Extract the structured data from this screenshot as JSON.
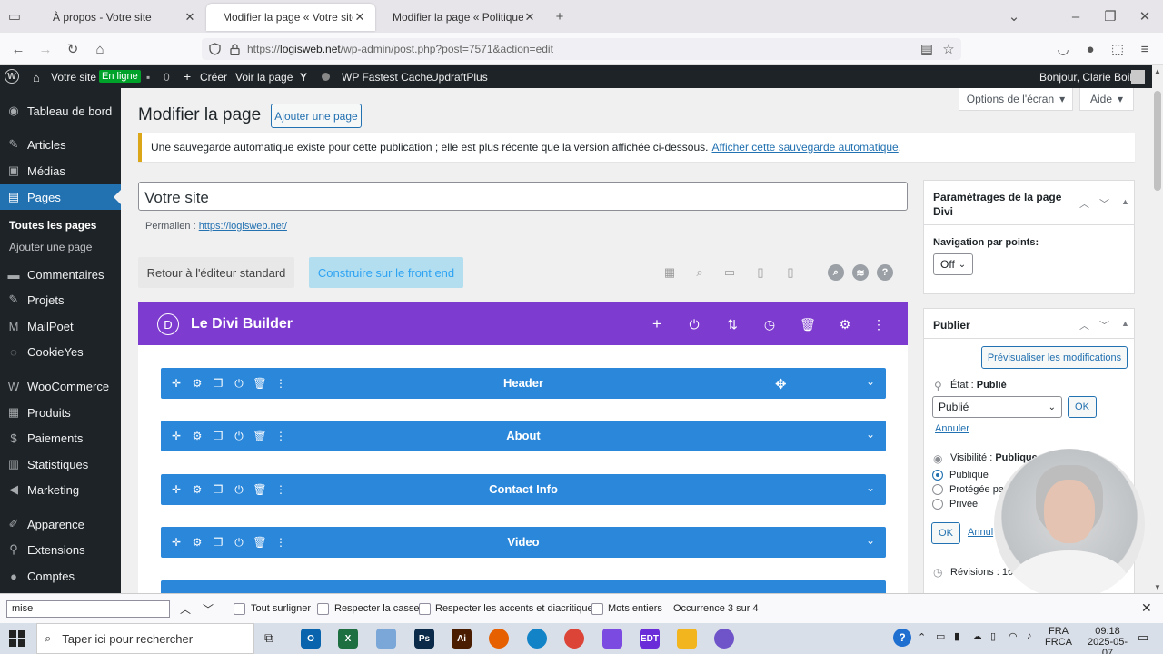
{
  "browser": {
    "tabs": [
      {
        "title": "À propos - Votre site",
        "active": false
      },
      {
        "title": "Modifier la page « Votre site » ‹",
        "active": true
      },
      {
        "title": "Modifier la page « Politique rela",
        "active": false
      }
    ],
    "url_prefix": "https://",
    "url_host": "logisweb.net",
    "url_path": "/wp-admin/post.php?post=7571&action=edit"
  },
  "adminbar": {
    "site_name": "Votre site",
    "online_badge": "En ligne",
    "comments_count": "0",
    "create": "Créer",
    "view_page": "Voir la page",
    "fastest_cache": "WP Fastest Cache",
    "updraft": "UpdraftPlus",
    "greeting": "Bonjour, Clarie Boily"
  },
  "sidebar": {
    "items": [
      {
        "label": "Tableau de bord",
        "icon": "dashboard-icon"
      },
      {
        "label": "Articles",
        "icon": "pin-icon"
      },
      {
        "label": "Médias",
        "icon": "media-icon"
      },
      {
        "label": "Pages",
        "icon": "pages-icon"
      },
      {
        "label": "Commentaires",
        "icon": "comment-icon"
      },
      {
        "label": "Projets",
        "icon": "pin-icon"
      },
      {
        "label": "MailPoet",
        "icon": "mailpoet-icon"
      },
      {
        "label": "CookieYes",
        "icon": "cookie-icon"
      },
      {
        "label": "WooCommerce",
        "icon": "woo-icon"
      },
      {
        "label": "Produits",
        "icon": "box-icon"
      },
      {
        "label": "Paiements",
        "icon": "card-icon"
      },
      {
        "label": "Statistiques",
        "icon": "chart-icon"
      },
      {
        "label": "Marketing",
        "icon": "megaphone-icon"
      },
      {
        "label": "Apparence",
        "icon": "brush-icon"
      },
      {
        "label": "Extensions",
        "icon": "plugin-icon"
      },
      {
        "label": "Comptes",
        "icon": "user-icon"
      }
    ],
    "sub_all": "Toutes les pages",
    "sub_add": "Ajouter une page"
  },
  "screen_options": "Options de l'écran",
  "help": "Aide",
  "page_title": "Modifier la page",
  "add_page": "Ajouter une page",
  "notice": {
    "text": "Une sauvegarde automatique existe pour cette publication ; elle est plus récente que la version affichée ci-dessous.",
    "link": "Afficher cette sauvegarde automatique",
    "end": "."
  },
  "post_title": "Votre site",
  "permalink_label": "Permalien :",
  "permalink_url": "https://logisweb.net/",
  "btn_standard": "Retour à l'éditeur standard",
  "btn_frontend": "Construire sur le front end",
  "divi": {
    "logo": "D",
    "title": "Le Divi Builder",
    "sections": [
      "Header",
      "About",
      "Contact Info",
      "Video"
    ]
  },
  "divi_settings": {
    "title_line1": "Paramétrages de la page",
    "title_line2": "Divi",
    "dot_nav_label": "Navigation par points:",
    "dot_nav_value": "Off"
  },
  "publish": {
    "title": "Publier",
    "preview": "Prévisualiser les modifications",
    "state_label": "État :",
    "state_value": "Publié",
    "select_value": "Publié",
    "ok": "OK",
    "cancel": "Annuler",
    "visibility_label": "Visibilité :",
    "visibility_value": "Publique",
    "radio_public": "Publique",
    "radio_protected": "Protégée pa",
    "radio_private": "Privée",
    "ok2": "OK",
    "cancel2": "Annul",
    "revisions": "Révisions : 16"
  },
  "findbar": {
    "query": "mise",
    "highlight_all": "Tout surligner",
    "match_case": "Respecter la casse",
    "match_diacritics": "Respecter les accents et diacritiques",
    "whole_words": "Mots entiers",
    "occurrence": "Occurrence 3 sur 4"
  },
  "taskbar": {
    "search_placeholder": "Taper ici pour rechercher",
    "lang1": "FRA",
    "lang2": "FRCA",
    "time": "09:18",
    "date": "2025-05-07",
    "apps": [
      {
        "name": "outlook",
        "label": "O",
        "color": "#0a64ad"
      },
      {
        "name": "excel",
        "label": "X",
        "color": "#1d6f42"
      },
      {
        "name": "notepad",
        "label": "",
        "color": "#7aa7d8"
      },
      {
        "name": "photoshop",
        "label": "Ps",
        "color": "#0b2a4a"
      },
      {
        "name": "illustrator",
        "label": "Ai",
        "color": "#4a1d00"
      },
      {
        "name": "firefox",
        "label": "",
        "color": "#e66000"
      },
      {
        "name": "edge",
        "label": "",
        "color": "#1383c7"
      },
      {
        "name": "chrome",
        "label": "",
        "color": "#db4437"
      },
      {
        "name": "copilot",
        "label": "",
        "color": "#7b4ae0"
      },
      {
        "name": "edt",
        "label": "EDT",
        "color": "#6a2bd9"
      },
      {
        "name": "explorer",
        "label": "",
        "color": "#f2b51d"
      },
      {
        "name": "settings",
        "label": "",
        "color": "#6f54c9"
      }
    ]
  }
}
